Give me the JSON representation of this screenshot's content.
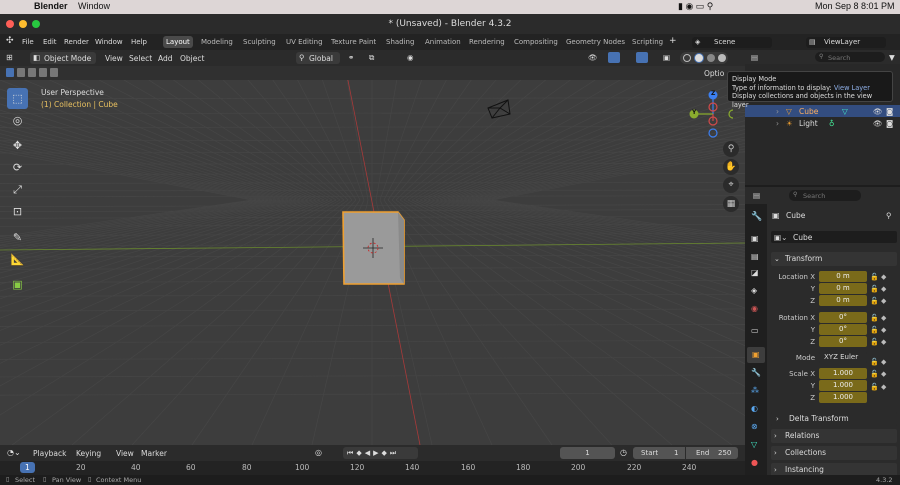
{
  "mac_menubar": {
    "app_name": "Blender",
    "menu": "Window",
    "datetime": "Mon Sep 8  8:01 PM"
  },
  "window": {
    "title": "* (Unsaved) - Blender 4.3.2"
  },
  "topbar": {
    "menus": [
      "File",
      "Edit",
      "Render",
      "Window",
      "Help"
    ],
    "workspaces": [
      "Layout",
      "Modeling",
      "Sculpting",
      "UV Editing",
      "Texture Paint",
      "Shading",
      "Animation",
      "Rendering",
      "Compositing",
      "Geometry Nodes",
      "Scripting"
    ],
    "active_workspace": "Layout",
    "scene": "Scene",
    "view_layer": "ViewLayer"
  },
  "viewport_header": {
    "mode": "Object Mode",
    "menus": [
      "View",
      "Select",
      "Add",
      "Object"
    ],
    "transform_orientation": "Global",
    "options_label": "Optio"
  },
  "viewport": {
    "view_name": "User Perspective",
    "collection_text": "(1) Collection | Cube",
    "gizmo_labels": {
      "z": "Z",
      "y": "Y"
    }
  },
  "tooltip": {
    "title": "Display Mode",
    "line1_prefix": "Type of information to display: ",
    "line1_value": "View Layer",
    "line2": "Display collections and objects in the view layer"
  },
  "outliner": {
    "search_placeholder": "Search",
    "items": [
      {
        "name": "Cube",
        "selected": true
      },
      {
        "name": "Light",
        "selected": false
      }
    ]
  },
  "properties": {
    "search_placeholder": "Search",
    "object_name": "Cube",
    "data_name": "Cube",
    "transform_label": "Transform",
    "location": {
      "label": "Location X",
      "x": "0 m",
      "y": "0 m",
      "z": "0 m"
    },
    "rotation": {
      "label": "Rotation X",
      "x": "0°",
      "y": "0°",
      "z": "0°"
    },
    "mode_label": "Mode",
    "mode_value": "XYZ Euler",
    "scale": {
      "label": "Scale X",
      "x": "1.000",
      "y": "1.000",
      "z": "1.000"
    },
    "axis_y": "Y",
    "axis_z": "Z",
    "panels": [
      "Delta Transform",
      "Relations",
      "Collections",
      "Instancing"
    ]
  },
  "timeline": {
    "menus": [
      "Playback",
      "Keying",
      "View",
      "Marker"
    ],
    "current_frame": "1",
    "start_label": "Start",
    "start_value": "1",
    "end_label": "End",
    "end_value": "250",
    "ruler_ticks": [
      "1",
      "20",
      "40",
      "60",
      "80",
      "100",
      "120",
      "140",
      "160",
      "180",
      "200",
      "220",
      "240"
    ]
  },
  "statusbar": {
    "items": [
      "Select",
      "Pan View",
      "Context Menu"
    ],
    "version": "4.3.2"
  },
  "colors": {
    "accent_blue": "#4772b3",
    "selection_orange": "#f0a030",
    "field_yellow": "#7a6a1a",
    "x_axis_red": "#d24a4a",
    "y_axis_green": "#8aac2e",
    "z_axis_blue": "#3c7ff0"
  }
}
